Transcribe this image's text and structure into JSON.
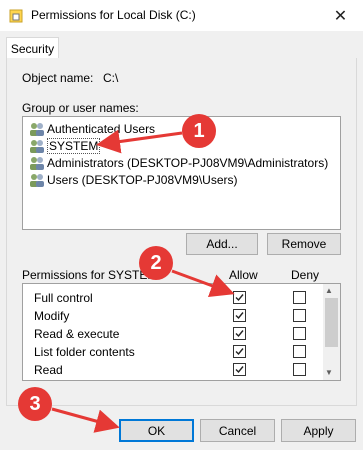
{
  "window": {
    "title": "Permissions for Local Disk (C:)",
    "close_glyph": "✕"
  },
  "tabs": [
    {
      "label": "Security"
    }
  ],
  "object": {
    "label": "Object name:",
    "value": "C:\\"
  },
  "groups": {
    "label": "Group or user names:",
    "items": [
      {
        "label": "Authenticated Users",
        "icon": "users-icon"
      },
      {
        "label": "SYSTEM",
        "icon": "users-icon",
        "selected": true
      },
      {
        "label": "Administrators (DESKTOP-PJ08VM9\\Administrators)",
        "icon": "users-icon"
      },
      {
        "label": "Users (DESKTOP-PJ08VM9\\Users)",
        "icon": "users-icon"
      }
    ]
  },
  "buttons": {
    "add": "Add...",
    "remove": "Remove",
    "ok": "OK",
    "cancel": "Cancel",
    "apply": "Apply"
  },
  "permissions": {
    "header": "Permissions for SYSTEM",
    "allow_label": "Allow",
    "deny_label": "Deny",
    "rows": [
      {
        "name": "Full control",
        "allow": true,
        "deny": false
      },
      {
        "name": "Modify",
        "allow": true,
        "deny": false
      },
      {
        "name": "Read & execute",
        "allow": true,
        "deny": false
      },
      {
        "name": "List folder contents",
        "allow": true,
        "deny": false
      },
      {
        "name": "Read",
        "allow": true,
        "deny": false
      }
    ]
  },
  "annotations": {
    "step1": "1",
    "step2": "2",
    "step3": "3",
    "color": "#e53935"
  }
}
